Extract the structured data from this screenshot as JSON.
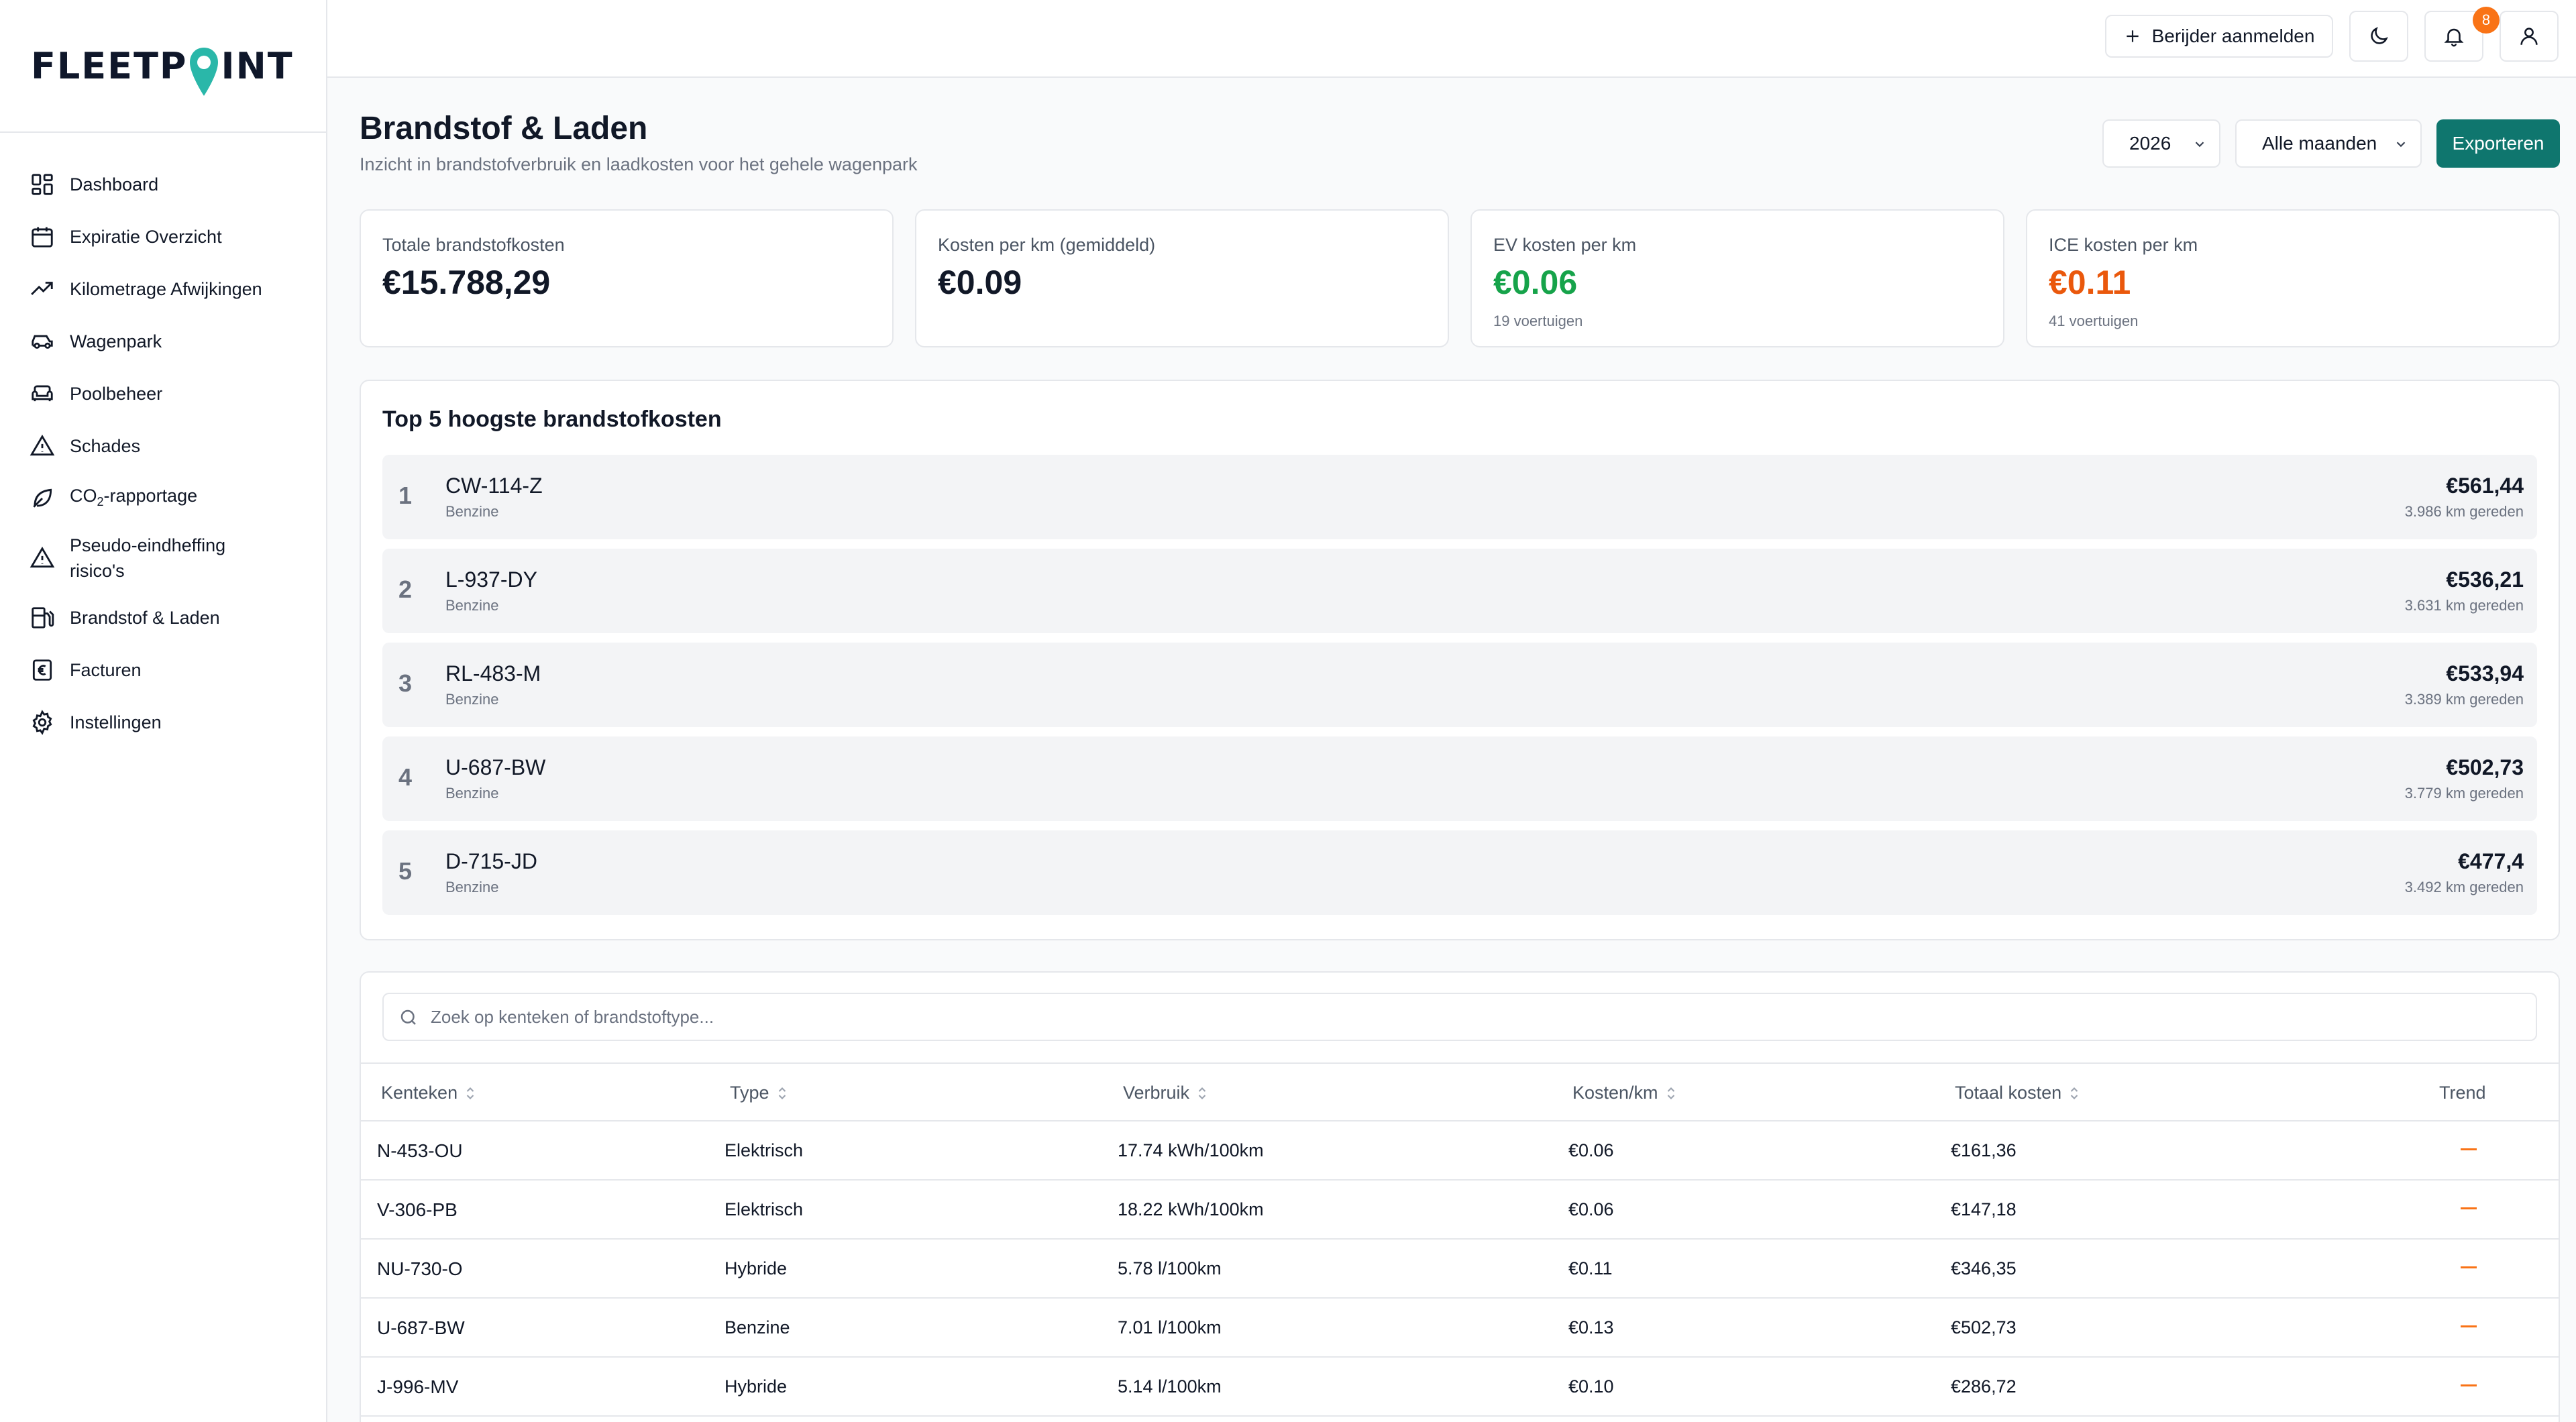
{
  "brand": {
    "name_left": "FLEETP",
    "name_right": "INT",
    "pin_color": "#2ab7a9"
  },
  "sidebar": {
    "items": [
      {
        "label": "Dashboard",
        "icon": "dashboard-grid-icon"
      },
      {
        "label": "Expiratie Overzicht",
        "icon": "calendar-icon"
      },
      {
        "label": "Kilometrage Afwijkingen",
        "icon": "trending-up-icon"
      },
      {
        "label": "Wagenpark",
        "icon": "car-icon"
      },
      {
        "label": "Poolbeheer",
        "icon": "sofa-icon"
      },
      {
        "label": "Schades",
        "icon": "warning-triangle-icon"
      },
      {
        "label_main": "CO",
        "label_sub": "2",
        "label_rest": "-rapportage",
        "icon": "leaf-icon"
      },
      {
        "label": "Pseudo-eindheffing risico's",
        "icon": "warning-triangle-icon"
      },
      {
        "label": "Brandstof & Laden",
        "icon": "fuel-pump-icon"
      },
      {
        "label": "Facturen",
        "icon": "euro-receipt-icon"
      },
      {
        "label": "Instellingen",
        "icon": "gear-icon"
      }
    ]
  },
  "topbar": {
    "register_driver_label": "Berijder aanmelden",
    "notification_count": "8",
    "icons": [
      "plus-icon",
      "moon-icon",
      "bell-icon",
      "user-icon"
    ]
  },
  "page": {
    "title": "Brandstof & Laden",
    "subtitle": "Inzicht in brandstofverbruik en laadkosten voor het gehele wagenpark",
    "year_select": "2026",
    "month_select": "Alle maanden",
    "export_label": "Exporteren"
  },
  "stats": [
    {
      "label": "Totale brandstofkosten",
      "value": "€15.788,29",
      "note": "",
      "color": "#111827"
    },
    {
      "label": "Kosten per km (gemiddeld)",
      "value": "€0.09",
      "note": "",
      "color": "#111827"
    },
    {
      "label": "EV kosten per km",
      "value": "€0.06",
      "note": "19 voertuigen",
      "color": "#16a34a"
    },
    {
      "label": "ICE kosten per km",
      "value": "€0.11",
      "note": "41 voertuigen",
      "color": "#ea580c"
    }
  ],
  "top5": {
    "title": "Top 5 hoogste brandstofkosten",
    "rows": [
      {
        "rank": "1",
        "plate": "CW-114-Z",
        "fuel": "Benzine",
        "amount": "€561,44",
        "km": "3.986 km gereden"
      },
      {
        "rank": "2",
        "plate": "L-937-DY",
        "fuel": "Benzine",
        "amount": "€536,21",
        "km": "3.631 km gereden"
      },
      {
        "rank": "3",
        "plate": "RL-483-M",
        "fuel": "Benzine",
        "amount": "€533,94",
        "km": "3.389 km gereden"
      },
      {
        "rank": "4",
        "plate": "U-687-BW",
        "fuel": "Benzine",
        "amount": "€502,73",
        "km": "3.779 km gereden"
      },
      {
        "rank": "5",
        "plate": "D-715-JD",
        "fuel": "Benzine",
        "amount": "€477,4",
        "km": "3.492 km gereden"
      }
    ]
  },
  "table": {
    "search_placeholder": "Zoek op kenteken of brandstoftype...",
    "headers": [
      "Kenteken",
      "Type",
      "Verbruik",
      "Kosten/km",
      "Totaal kosten",
      "Trend"
    ],
    "rows": [
      {
        "plate": "N-453-OU",
        "type": "Elektrisch",
        "usage": "17.74 kWh/100km",
        "cost_km": "€0.06",
        "total": "€161,36",
        "trend": "neutral"
      },
      {
        "plate": "V-306-PB",
        "type": "Elektrisch",
        "usage": "18.22 kWh/100km",
        "cost_km": "€0.06",
        "total": "€147,18",
        "trend": "neutral"
      },
      {
        "plate": "NU-730-O",
        "type": "Hybride",
        "usage": "5.78 l/100km",
        "cost_km": "€0.11",
        "total": "€346,35",
        "trend": "neutral"
      },
      {
        "plate": "U-687-BW",
        "type": "Benzine",
        "usage": "7.01 l/100km",
        "cost_km": "€0.13",
        "total": "€502,73",
        "trend": "neutral"
      },
      {
        "plate": "J-996-MV",
        "type": "Hybride",
        "usage": "5.14 l/100km",
        "cost_km": "€0.10",
        "total": "€286,72",
        "trend": "neutral"
      }
    ]
  }
}
